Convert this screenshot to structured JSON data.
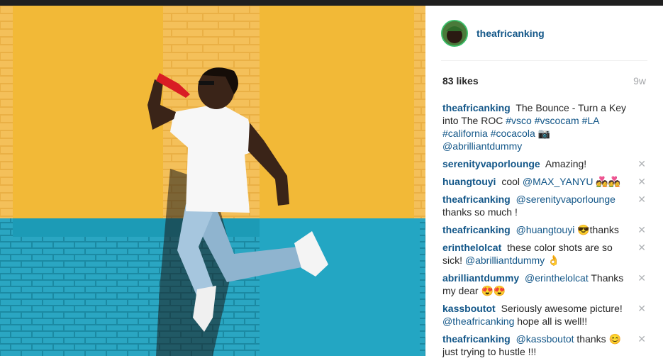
{
  "post": {
    "author": "theafricanking",
    "likes": "83 likes",
    "age": "9w"
  },
  "caption": {
    "user": "theafricanking",
    "text": "The Bounce - Turn a Key into The ROC",
    "tags": "#vsco #vscocam #LA #california #cocacola",
    "emoji": "📷",
    "mention": "@abrilliantdummy"
  },
  "comments": [
    {
      "user": "serenityvaporlounge",
      "text": "Amazing!",
      "close": "✕"
    },
    {
      "user": "huangtouyi",
      "text": "cool",
      "mention": "@MAX_YANYU",
      "emoji": "💑💑",
      "close": "✕"
    },
    {
      "user": "theafricanking",
      "mention": "@serenityvaporlounge",
      "text": "thanks so much !",
      "close": "✕"
    },
    {
      "user": "theafricanking",
      "mention": "@huangtouyi",
      "emoji": "😎",
      "text": "thanks",
      "close": "✕"
    },
    {
      "user": "erinthelolcat",
      "text": "these color shots are so sick!",
      "mention": "@abrilliantdummy",
      "emoji": "👌",
      "close": "✕"
    },
    {
      "user": "abrilliantdummy",
      "mention": "@erinthelolcat",
      "text": "Thanks my dear",
      "emoji": "😍😍",
      "close": "✕"
    },
    {
      "user": "kassboutot",
      "text": "Seriously awesome picture!",
      "mention": "@theafricanking",
      "text2": "hope all is well!!",
      "close": "✕"
    },
    {
      "user": "theafricanking",
      "mention": "@kassboutot",
      "text": "thanks",
      "emoji": "😊",
      "text2": "just trying to hustle !!!",
      "close": "✕"
    }
  ],
  "colors": {
    "link": "#125688",
    "wall_yellow": "#f3bb3c",
    "wall_teal": "#27a7c0",
    "accent_ring": "#3cbf6a"
  }
}
